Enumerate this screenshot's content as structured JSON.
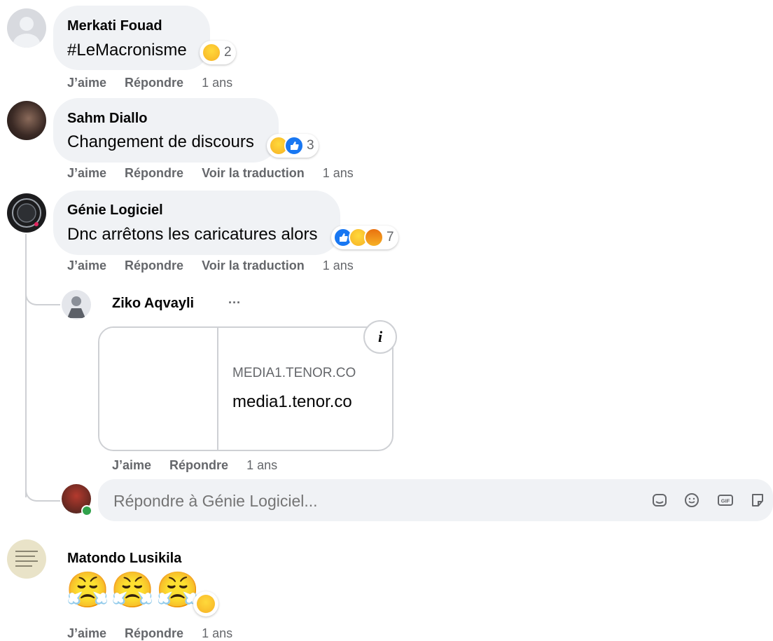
{
  "comments": [
    {
      "author": "Merkati Fouad",
      "text": "#LeMacronisme",
      "reactions": [
        "haha"
      ],
      "reaction_count": "2",
      "actions": {
        "like": "J’aime",
        "reply": "Répondre",
        "time": "1 ans"
      }
    },
    {
      "author": "Sahm Diallo",
      "text": "Changement de discours",
      "reactions": [
        "haha",
        "like"
      ],
      "reaction_count": "3",
      "actions": {
        "like": "J’aime",
        "reply": "Répondre",
        "translate": "Voir la traduction",
        "time": "1 ans"
      }
    },
    {
      "author": "Génie Logiciel",
      "text": "Dnc arrêtons les caricatures alors",
      "reactions": [
        "like",
        "haha",
        "angry"
      ],
      "reaction_count": "7",
      "actions": {
        "like": "J’aime",
        "reply": "Répondre",
        "translate": "Voir la traduction",
        "time": "1 ans"
      }
    },
    {
      "author": "Matondo Lusikila",
      "text": "😤😤😤",
      "reactions": [
        "haha"
      ],
      "reaction_count": "",
      "actions": {
        "like": "J’aime",
        "reply": "Répondre",
        "time": "1 ans"
      }
    }
  ],
  "reply": {
    "author": "Ziko Aqvayli",
    "more": "···",
    "link_card": {
      "domain": "MEDIA1.TENOR.CO",
      "title": "media1.tenor.co",
      "info_icon": "i"
    },
    "actions": {
      "like": "J’aime",
      "reply": "Répondre",
      "time": "1 ans"
    }
  },
  "reply_input": {
    "placeholder": "Répondre à Génie Logiciel...",
    "tools": [
      "avatar-sticker-icon",
      "emoji-icon",
      "gif-icon",
      "sticker-icon"
    ]
  },
  "colors": {
    "bubble": "#f0f2f5",
    "secondary_text": "#65676b",
    "like_blue": "#1877f2",
    "haha_yellow": "#f7b125",
    "online_green": "#31a24c"
  }
}
